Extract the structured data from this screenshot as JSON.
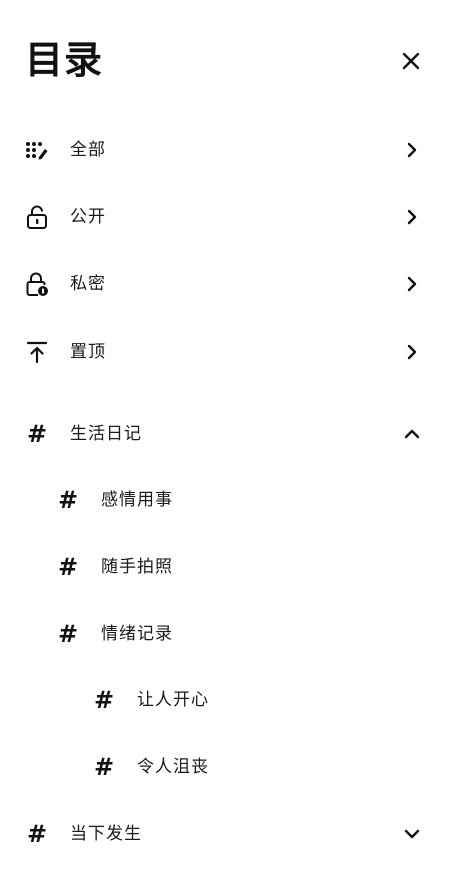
{
  "header": {
    "title": "目录",
    "close_icon": "close-icon"
  },
  "menu": {
    "items": [
      {
        "label": "全部",
        "icon": "grid-edit-icon",
        "arrow": "chevron-right-icon"
      },
      {
        "label": "公开",
        "icon": "unlock-icon",
        "arrow": "chevron-right-icon"
      },
      {
        "label": "私密",
        "icon": "lock-icon",
        "arrow": "chevron-right-icon"
      },
      {
        "label": "置顶",
        "icon": "pin-top-icon",
        "arrow": "chevron-right-icon"
      }
    ]
  },
  "tags": {
    "hash_symbol": "#",
    "groups": [
      {
        "label": "生活日记",
        "expanded": true,
        "arrow": "chevron-up-icon",
        "children": [
          {
            "label": "感情用事"
          },
          {
            "label": "随手拍照"
          },
          {
            "label": "情绪记录",
            "children": [
              {
                "label": "让人开心"
              },
              {
                "label": "令人沮丧"
              }
            ]
          }
        ]
      },
      {
        "label": "当下发生",
        "expanded": false,
        "arrow": "chevron-down-icon"
      }
    ]
  },
  "colors": {
    "text": "#111111",
    "background": "#ffffff"
  }
}
